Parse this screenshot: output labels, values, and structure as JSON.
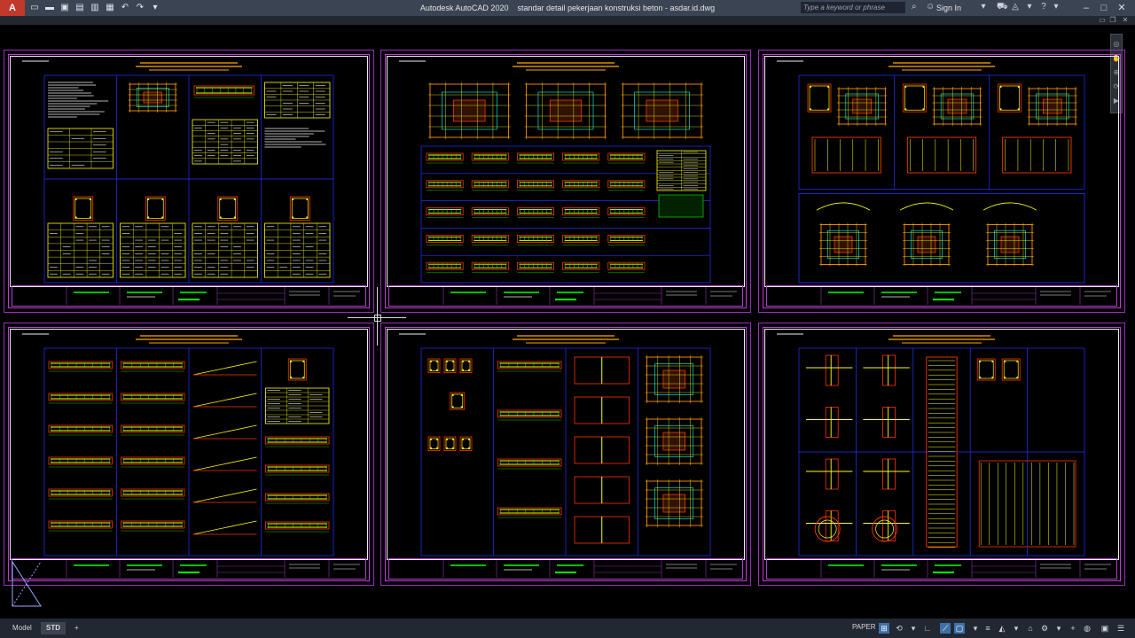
{
  "titlebar": {
    "app_letter": "A",
    "title": "Autodesk AutoCAD 2020    standar detail pekerjaan konstruksi beton - asdar.id.dwg",
    "search_placeholder": "Type a keyword or phrase",
    "signin_label": "Sign In"
  },
  "statusbar": {
    "tabs": [
      "Model",
      "STD"
    ],
    "active_tab": "STD",
    "paper_label": "PAPER"
  },
  "colors": {
    "sheet_outer": "#9b2dc2",
    "frame": "#eeeeee",
    "titleblock_line": "#b23fd0",
    "section_border": "#2233ff",
    "rebar": "#ffff00",
    "dims": "#00ff00",
    "concrete": "#ff3300",
    "heading": "#ffaa00",
    "text": "#f0f0f0",
    "cyan": "#00ffff"
  },
  "sheets": [
    {
      "id": "sheet-1",
      "type": "tables"
    },
    {
      "id": "sheet-2",
      "type": "frames"
    },
    {
      "id": "sheet-3",
      "type": "foundations"
    },
    {
      "id": "sheet-4",
      "type": "beams"
    },
    {
      "id": "sheet-5",
      "type": "columns"
    },
    {
      "id": "sheet-6",
      "type": "joints"
    }
  ]
}
